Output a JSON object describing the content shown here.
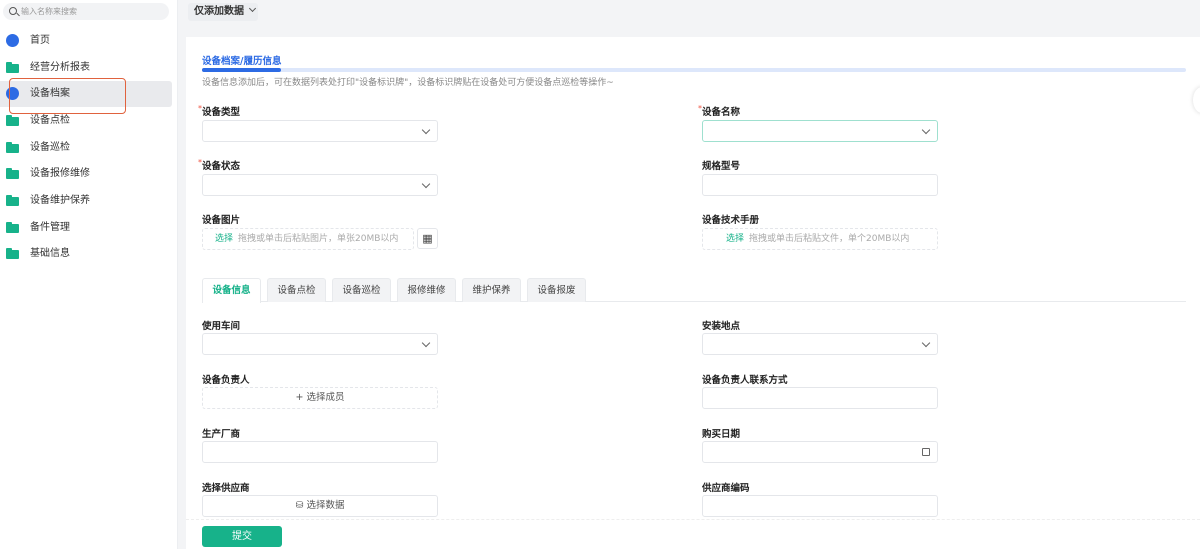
{
  "sidebar": {
    "search_placeholder": "输入名称来搜索",
    "items": [
      {
        "label": "首页",
        "icon": "home-icon"
      },
      {
        "label": "经营分析报表",
        "icon": "folder-icon"
      },
      {
        "label": "设备档案",
        "icon": "document-icon",
        "active": true
      },
      {
        "label": "设备点检",
        "icon": "folder-icon"
      },
      {
        "label": "设备巡检",
        "icon": "folder-icon"
      },
      {
        "label": "设备报修维修",
        "icon": "folder-icon"
      },
      {
        "label": "设备维护保养",
        "icon": "folder-icon"
      },
      {
        "label": "备件管理",
        "icon": "folder-icon"
      },
      {
        "label": "基础信息",
        "icon": "folder-icon"
      }
    ]
  },
  "topbar": {
    "mode_label": "仅添加数据"
  },
  "form": {
    "section_title": "设备档案/履历信息",
    "hint": "设备信息添加后，可在数据列表处打印\"设备标识牌\"，设备标识牌贴在设备处可方便设备点巡检等操作~",
    "required_mark": "*",
    "device_type": "设备类型",
    "device_name": "设备名称",
    "device_status": "设备状态",
    "spec_model": "规格型号",
    "device_image": "设备图片",
    "tech_manual": "设备技术手册",
    "choose": "选择",
    "image_hint": "拖拽或单击后粘贴图片，单张20MB以内",
    "file_hint": "拖拽或单击后粘贴文件，单个20MB以内",
    "tabs": [
      "设备信息",
      "设备点检",
      "设备巡检",
      "报修维修",
      "维护保养",
      "设备报废"
    ],
    "workshop": "使用车间",
    "location": "安装地点",
    "owner": "设备负责人",
    "owner_contact": "设备负责人联系方式",
    "select_member": "+ 选择成员",
    "manufacturer": "生产厂商",
    "purchase_date": "购买日期",
    "supplier": "选择供应商",
    "select_data": "选择数据",
    "supplier_code": "供应商编码",
    "submit": "提交"
  },
  "colors": {
    "accent": "#17b28a",
    "primary": "#2d6be4",
    "highlight": "#e0623e"
  }
}
